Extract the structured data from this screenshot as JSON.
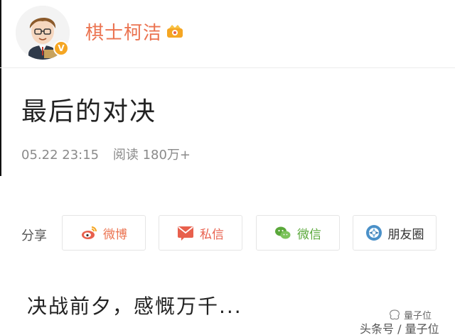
{
  "header": {
    "username": "棋士柯洁",
    "avatar_icon": "cartoon-avatar-icon",
    "verified_icon": "verified-badge-icon",
    "verified_mark": "V",
    "vip_icon": "vip-crown-icon"
  },
  "post": {
    "title": "最后的对决",
    "date": "05.22 23:15",
    "reads": "阅读 180万+",
    "body": "决战前夕，感慨万千..."
  },
  "share": {
    "label": "分享",
    "buttons": [
      {
        "label": "微博",
        "icon": "weibo-icon"
      },
      {
        "label": "私信",
        "icon": "message-icon"
      },
      {
        "label": "微信",
        "icon": "wechat-icon"
      },
      {
        "label": "朋友圈",
        "icon": "moments-icon"
      }
    ]
  },
  "watermark": {
    "line1": "量子位",
    "line2": "头条号 / 量子位"
  },
  "colors": {
    "username": "#eb7350",
    "weibo": "#eb7350",
    "dm": "#e8604d",
    "wechat": "#5aa83a",
    "moments": "#4a90c8"
  }
}
